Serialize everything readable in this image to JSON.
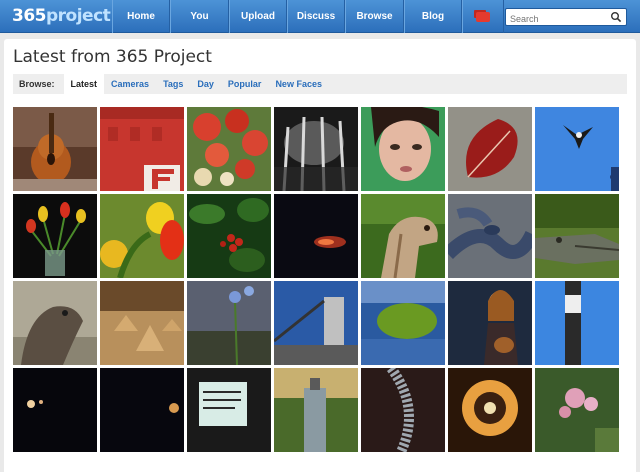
{
  "header": {
    "logo_number": "365",
    "logo_word": "project",
    "nav": [
      {
        "label": "Home"
      },
      {
        "label": "You"
      },
      {
        "label": "Upload"
      },
      {
        "label": "Discuss"
      },
      {
        "label": "Browse"
      },
      {
        "label": "Blog"
      }
    ],
    "chat_icon": "chat-bubbles-icon",
    "search": {
      "placeholder": "Search",
      "icon": "magnifier-icon"
    }
  },
  "main": {
    "title": "Latest from 365 Project",
    "browse": {
      "label": "Browse:",
      "tabs": [
        {
          "label": "Latest",
          "active": true
        },
        {
          "label": "Cameras"
        },
        {
          "label": "Tags"
        },
        {
          "label": "Day"
        },
        {
          "label": "Popular"
        },
        {
          "label": "New Faces"
        }
      ]
    },
    "photo_rows": [
      [
        "guitar",
        "red-building-letter-e",
        "salad",
        "bw-fence",
        "woman-face",
        "red-leaf",
        "bird-in-sky"
      ],
      [
        "tulips-vase",
        "yellow-red-tulips",
        "red-berries",
        "night-lights",
        "camel",
        "snake",
        "alligator"
      ],
      [
        "otter",
        "sand-pyramids",
        "blue-flower",
        "industrial-tower",
        "green-fruit",
        "girl-with-guitar",
        "pole-sign"
      ],
      [
        "dark-lights",
        "dark-glow",
        "ticket",
        "lamp-post",
        "beaded-jewelry",
        "candle-glow",
        "pink-flowers"
      ]
    ]
  }
}
